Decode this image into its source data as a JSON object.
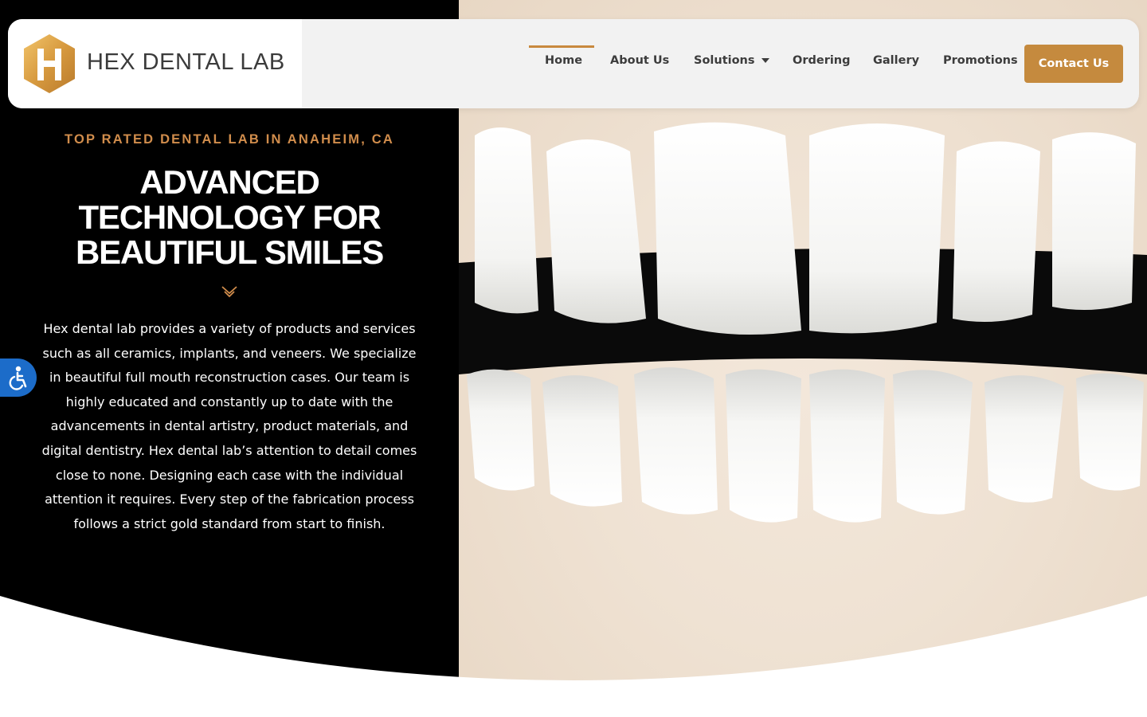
{
  "header": {
    "logo_text": "HEX DENTAL LAB",
    "nav": [
      {
        "label": "Home",
        "active": true
      },
      {
        "label": "About Us"
      },
      {
        "label": "Solutions",
        "dropdown": true
      },
      {
        "label": "Ordering"
      },
      {
        "label": "Gallery"
      },
      {
        "label": "Promotions"
      }
    ],
    "cta_label": "Contact Us"
  },
  "hero": {
    "kicker": "TOP RATED DENTAL LAB IN ANAHEIM, CA",
    "headline": "ADVANCED TECHNOLOGY FOR BEAUTIFUL SMILES",
    "body": "Hex dental lab provides a variety of products and services such as all ceramics, implants, and veneers. We specialize in beautiful full mouth reconstruction cases. Our team is highly educated and constantly up to date with the advancements in dental artistry, product materials, and digital dentistry. Hex dental lab’s attention to detail comes close to none. Designing each case with the individual attention it requires. Every step of the fabrication process follows a strict gold standard from start to finish.",
    "image": "dental-crowns-photo"
  },
  "icons": {
    "accessibility": "accessibility-icon",
    "scroll": "chevron-down-icon",
    "logo": "hex-logo-icon"
  },
  "colors": {
    "accent": "#c58a3e",
    "kicker": "#d18d4c",
    "hero_bg": "#000000",
    "a11y": "#1c6cc9"
  }
}
